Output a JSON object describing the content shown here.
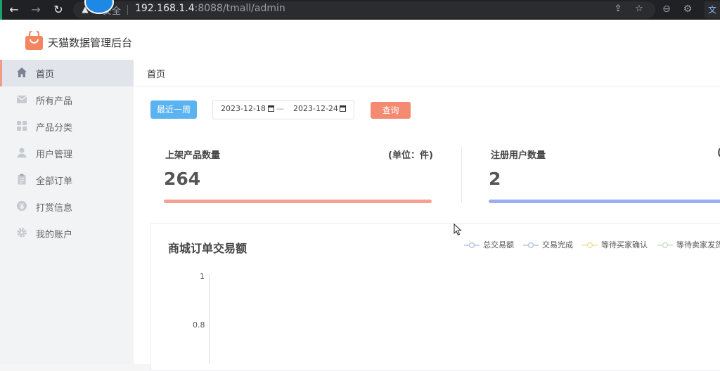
{
  "browser": {
    "back_glyph": "←",
    "forward_glyph": "→",
    "reload_glyph": "↻",
    "warning_glyph": "▲",
    "secure_label": "安全",
    "url_host": "192.168.1.4",
    "url_rest": ":8088/tmall/admin",
    "share_glyph": "⇪",
    "star_glyph": "☆",
    "minus_glyph": "⊖",
    "gear_glyph": "⚙",
    "lang_glyph": "文"
  },
  "app": {
    "title": "天猫数据管理后台"
  },
  "sidebar": {
    "items": [
      {
        "label": "首页",
        "icon": "home-icon"
      },
      {
        "label": "所有产品",
        "icon": "mail-icon"
      },
      {
        "label": "产品分类",
        "icon": "grid-icon"
      },
      {
        "label": "用户管理",
        "icon": "user-icon"
      },
      {
        "label": "全部订单",
        "icon": "clipboard-icon"
      },
      {
        "label": "打赏信息",
        "icon": "coin-icon"
      },
      {
        "label": "我的账户",
        "icon": "gear-icon"
      }
    ],
    "active_index": 0,
    "active_accent": "#f19a86"
  },
  "breadcrumb": "首页",
  "filter": {
    "week_button": "最近一周",
    "start_date": "2023-12-18",
    "separator": "—",
    "end_date": "2023-12-24",
    "query_button": "查询",
    "week_color": "#5ab3f0",
    "query_color": "#f58a72"
  },
  "stats": [
    {
      "label": "上架产品数量",
      "unit": "(单位：件)",
      "value": "264",
      "bar_color": "#f5a192"
    },
    {
      "label": "注册用户数量",
      "unit": "(",
      "value": "2",
      "bar_color": "#9aaef0"
    }
  ],
  "chart_data": {
    "type": "line",
    "title": "商城订单交易额",
    "series": [
      {
        "name": "总交易额",
        "color": "#b8c8e0",
        "values": []
      },
      {
        "name": "交易完成",
        "color": "#b8c8e0",
        "values": []
      },
      {
        "name": "等待买家确认",
        "color": "#f0e1a0",
        "values": []
      },
      {
        "name": "等待卖家发货",
        "color": "#c7e3c0",
        "values": []
      }
    ],
    "y_ticks": [
      "1",
      "0.8"
    ],
    "ylim": [
      0,
      1
    ]
  }
}
